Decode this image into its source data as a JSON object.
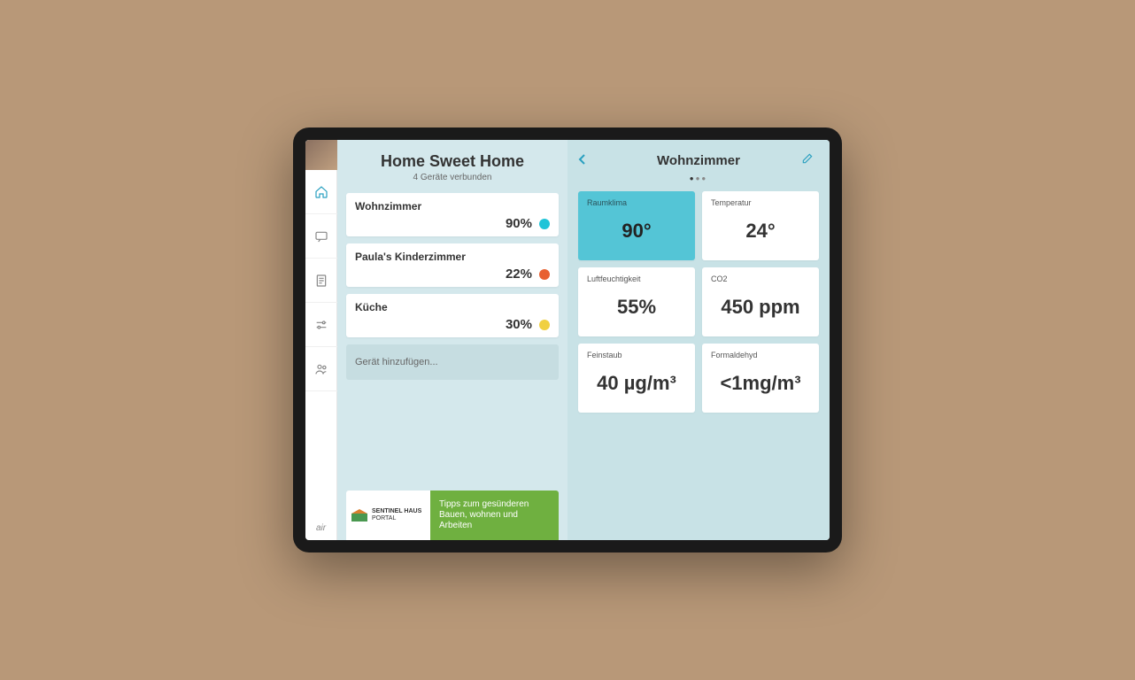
{
  "header": {
    "title": "Home Sweet Home",
    "subtitle": "4 Geräte verbunden"
  },
  "rooms": [
    {
      "name": "Wohnzimmer",
      "value": "90%",
      "color": "#20c4d8"
    },
    {
      "name": "Paula's Kinderzimmer",
      "value": "22%",
      "color": "#e86030"
    },
    {
      "name": "Küche",
      "value": "30%",
      "color": "#f0d040"
    }
  ],
  "add_device_label": "Gerät hinzufügen...",
  "promo": {
    "brand_top": "SENTINEL HAUS",
    "brand_bottom": "PORTAL",
    "text": "Tipps zum gesünderen Bauen, wohnen und Arbeiten"
  },
  "detail": {
    "title": "Wohnzimmer",
    "metrics": [
      {
        "label": "Raumklima",
        "value": "90°",
        "highlight": true
      },
      {
        "label": "Temperatur",
        "value": "24°"
      },
      {
        "label": "Luftfeuchtigkeit",
        "value": "55%"
      },
      {
        "label": "CO2",
        "value": "450 ppm"
      },
      {
        "label": "Feinstaub",
        "value": "40 µg/m³"
      },
      {
        "label": "Formaldehyd",
        "value": "<1mg/m³"
      }
    ]
  },
  "brand": "air"
}
